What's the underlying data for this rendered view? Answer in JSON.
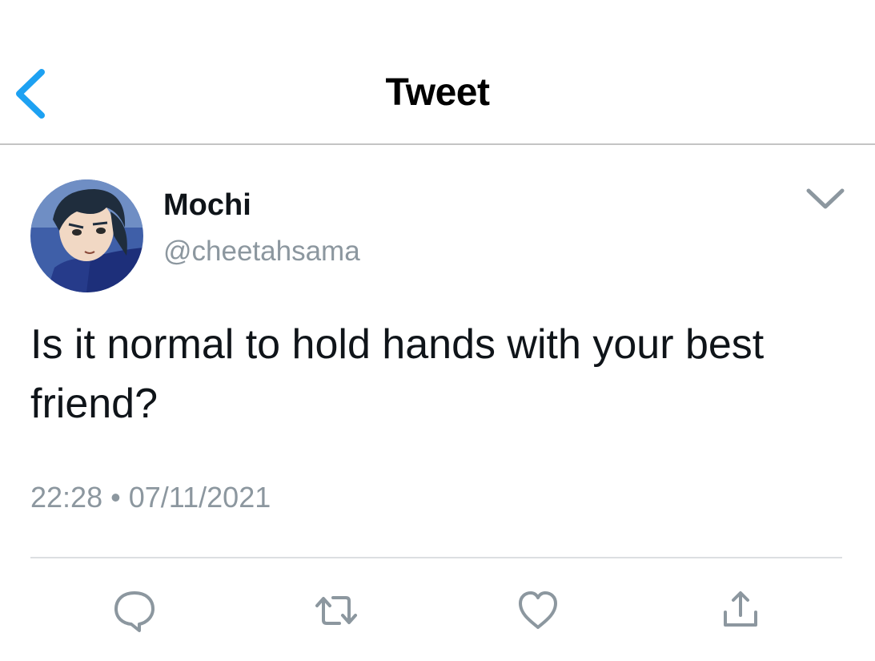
{
  "header": {
    "back_icon": "chevron-left-icon",
    "title": "Tweet"
  },
  "tweet": {
    "author": {
      "name": "Mochi",
      "handle": "@cheetahsama",
      "avatar": "anime-character-avatar"
    },
    "menu_icon": "chevron-down-icon",
    "text": "Is it normal to hold hands with your best friend?",
    "time": "22:28",
    "separator": "•",
    "date": "07/11/2021"
  },
  "actions": [
    {
      "name": "reply",
      "icon": "reply-icon"
    },
    {
      "name": "retweet",
      "icon": "retweet-icon"
    },
    {
      "name": "like",
      "icon": "heart-icon"
    },
    {
      "name": "share",
      "icon": "share-icon"
    }
  ],
  "colors": {
    "accent": "#1da1f2",
    "text": "#0f1419",
    "secondary_text": "#8c979f",
    "icon_gray": "#8c979f",
    "divider": "#dcdfe2"
  }
}
